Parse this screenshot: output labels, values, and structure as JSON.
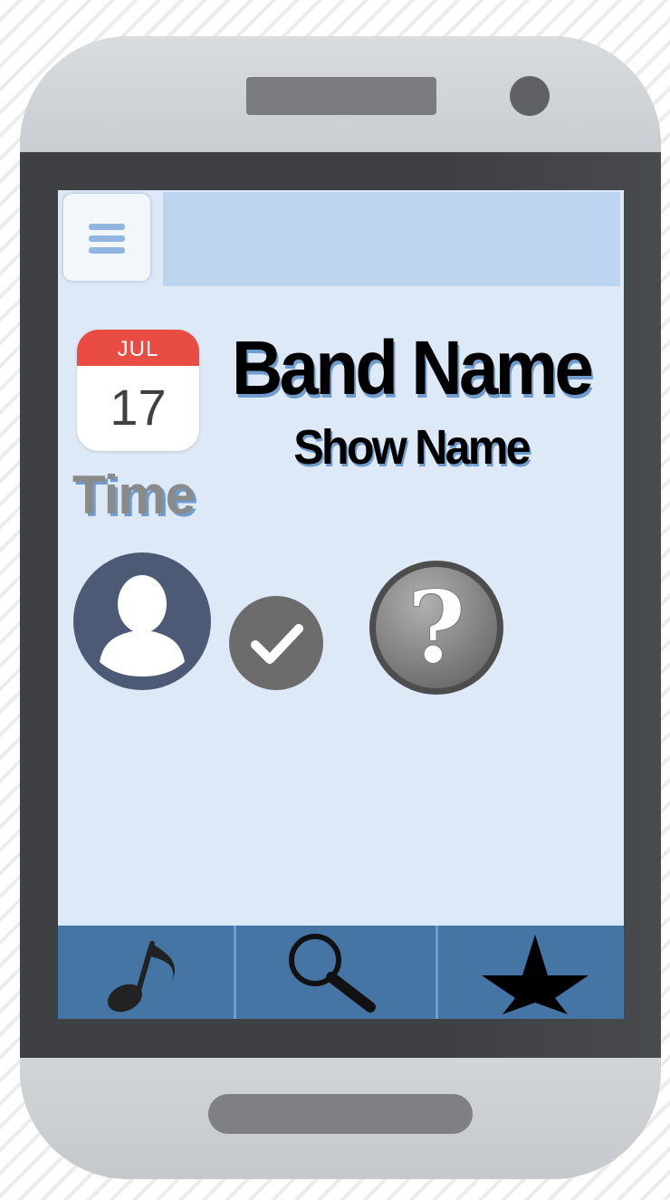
{
  "device": {
    "frame_color": "#cfd2d6",
    "bezel_color": "#3f4043",
    "background_pattern": "diagonal-stripes"
  },
  "header": {
    "menu_icon": "hamburger-menu-icon",
    "bar_color": "#bdd4ee"
  },
  "event": {
    "calendar_month": "JUL",
    "calendar_day": "17",
    "time_label": "Time",
    "band_name": "Band Name",
    "show_name": "Show Name"
  },
  "actions": {
    "avatar_icon": "user-avatar-icon",
    "check_icon": "checkmark-icon",
    "help_icon": "question-mark-icon"
  },
  "tab_bar": {
    "color": "#4575a4",
    "tabs": [
      {
        "icon": "music-note-icon"
      },
      {
        "icon": "search-icon"
      },
      {
        "icon": "star-icon"
      }
    ]
  },
  "colors": {
    "screen_bg": "#dde9f6",
    "calendar_red": "#e84c43",
    "text_shadow_blue": "#6f9ccd",
    "avatar_circle": "#4c5a75"
  }
}
